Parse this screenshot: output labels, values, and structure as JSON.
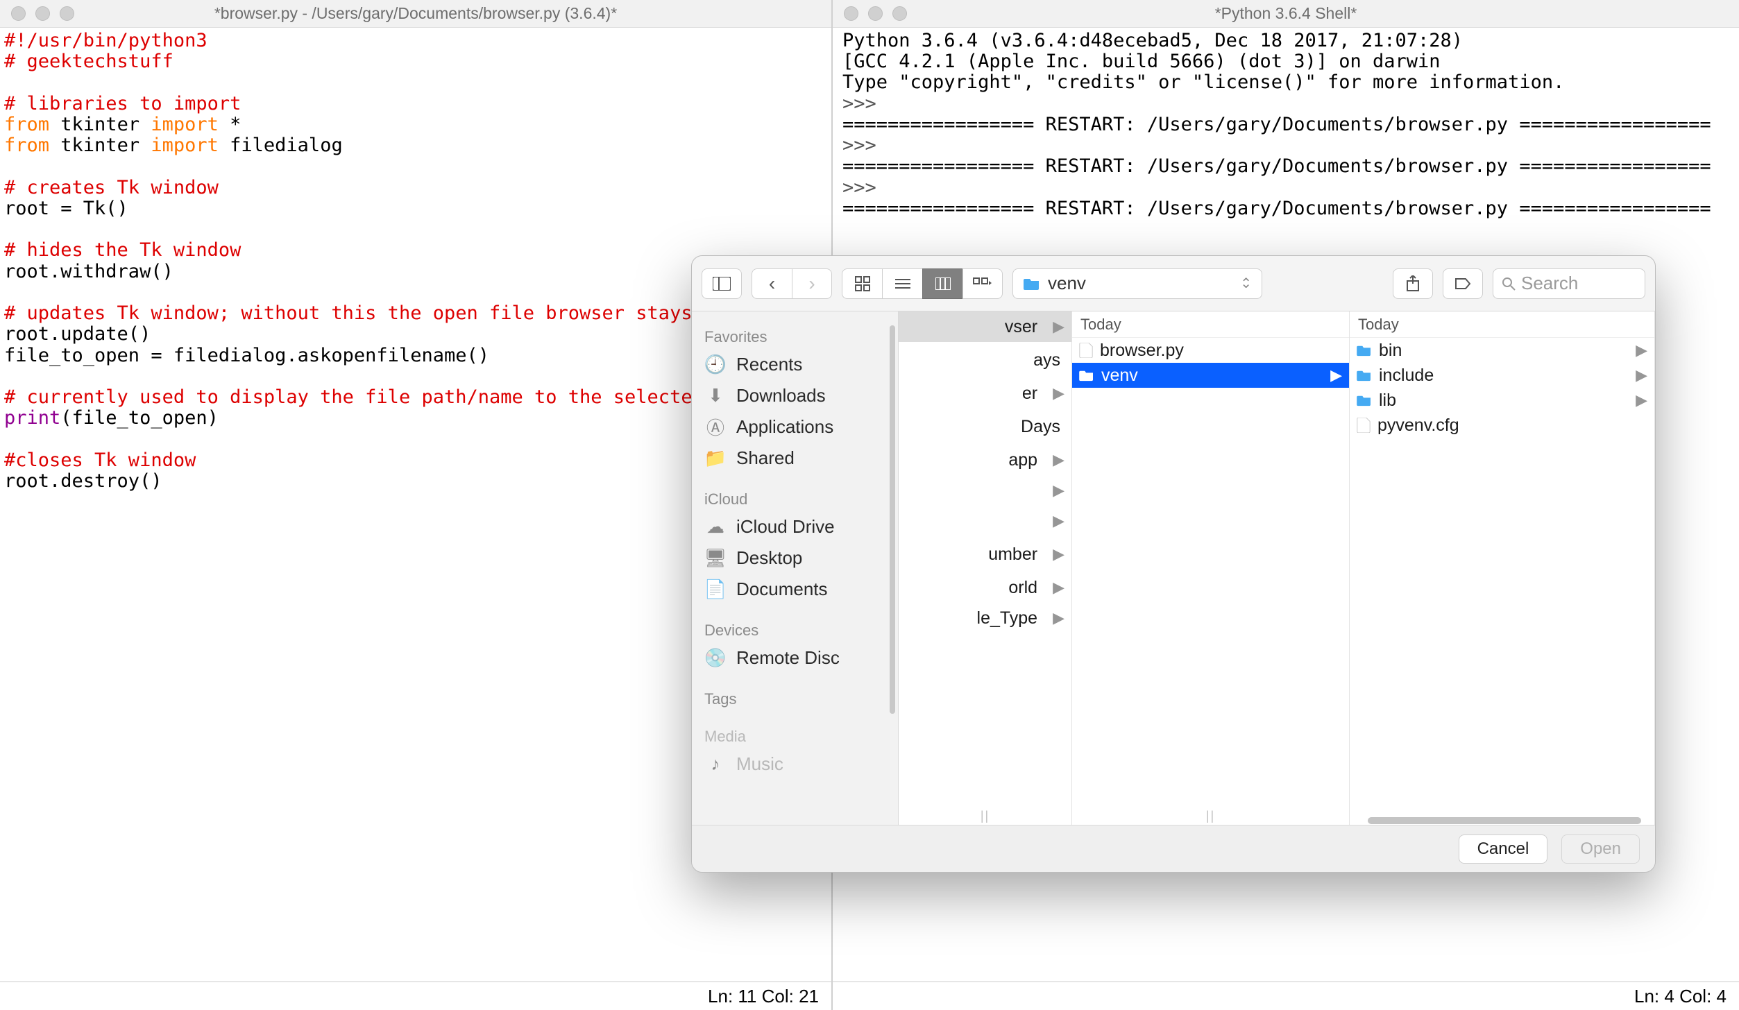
{
  "editor": {
    "title": "*browser.py - /Users/gary/Documents/browser.py (3.6.4)*",
    "status": "Ln: 11  Col: 21",
    "code": {
      "l1": "#!/usr/bin/python3",
      "l2": "# geektechstuff",
      "l3": " ",
      "l4": "# libraries to import",
      "l5_from": "from",
      "l5_mod": " tkinter ",
      "l5_import": "import",
      "l5_rest": " *",
      "l6_from": "from",
      "l6_mod": " tkinter ",
      "l6_import": "import",
      "l6_rest": " filedialog",
      "l7": " ",
      "l8": "# creates Tk window",
      "l9": "root = Tk()",
      "l10": " ",
      "l11": "# hides the Tk window",
      "l12": "root.withdraw()",
      "l13": " ",
      "l14": "# updates Tk window; without this the open file browser stays open",
      "l15": "root.update()",
      "l16": "file_to_open = filedialog.askopenfilename()",
      "l17": " ",
      "l18": "# currently used to display the file path/name to the selected file",
      "l19_print": "print",
      "l19_rest": "(file_to_open)",
      "l20": " ",
      "l21": "#closes Tk window",
      "l22": "root.destroy()"
    }
  },
  "shell": {
    "title": "*Python 3.6.4 Shell*",
    "status": "Ln: 4  Col: 4",
    "lines": {
      "l1": "Python 3.6.4 (v3.6.4:d48ecebad5, Dec 18 2017, 21:07:28)",
      "l2": "[GCC 4.2.1 (Apple Inc. build 5666) (dot 3)] on darwin",
      "l3": "Type \"copyright\", \"credits\" or \"license()\" for more information.",
      "p1": ">>>",
      "r1": "================= RESTART: /Users/gary/Documents/browser.py =================",
      "p2": ">>>",
      "r2": "================= RESTART: /Users/gary/Documents/browser.py =================",
      "p3": ">>>",
      "r3": "================= RESTART: /Users/gary/Documents/browser.py ================="
    }
  },
  "dialog": {
    "path_label": "venv",
    "search_placeholder": "Search",
    "buttons": {
      "cancel": "Cancel",
      "open": "Open"
    },
    "sidebar": {
      "groups": {
        "favorites": "Favorites",
        "icloud": "iCloud",
        "devices": "Devices",
        "tags": "Tags",
        "media": "Media"
      },
      "items": {
        "recents": "Recents",
        "downloads": "Downloads",
        "applications": "Applications",
        "shared": "Shared",
        "icloud_drive": "iCloud Drive",
        "desktop": "Desktop",
        "documents": "Documents",
        "remote_disc": "Remote Disc",
        "music": "Music"
      }
    },
    "columns": {
      "col0": {
        "rows": [
          {
            "label": "vser",
            "folder": true,
            "sel_gray": true
          },
          {
            "label": "ays"
          },
          {
            "label": "er",
            "folder": true
          },
          {
            "label": "Days"
          },
          {
            "label": "app",
            "folder": true
          },
          {
            "label": "",
            "folder": true
          },
          {
            "label": "",
            "folder": true
          },
          {
            "label": "umber",
            "folder": true
          },
          {
            "label": "orld",
            "folder": true
          },
          {
            "label": "le_Type",
            "folder": true
          }
        ],
        "row_classes": [
          "",
          "gap",
          "",
          "gap",
          "",
          "",
          "",
          "gap",
          "",
          ""
        ]
      },
      "col1": {
        "header": "Today",
        "rows": [
          {
            "label": "browser.py",
            "file": true
          },
          {
            "label": "venv",
            "folder": true,
            "sel_blue": true
          }
        ]
      },
      "col2": {
        "header": "Today",
        "rows": [
          {
            "label": "bin",
            "folder": true
          },
          {
            "label": "include",
            "folder": true
          },
          {
            "label": "lib",
            "folder": true
          },
          {
            "label": "pyvenv.cfg",
            "file": true
          }
        ]
      }
    }
  }
}
